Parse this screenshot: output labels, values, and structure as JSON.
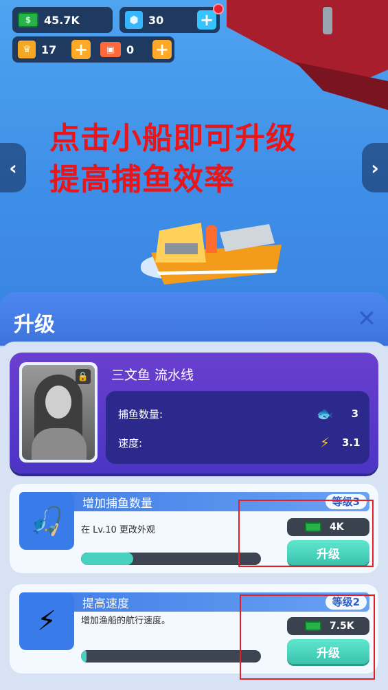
{
  "hud": {
    "cash": "45.7K",
    "gems": "30",
    "crowns": "17",
    "tickets": "0",
    "icons": {
      "cash": "cash-icon",
      "gem": "gem-icon",
      "crown": "crown-icon",
      "ticket": "ticket-icon",
      "plus": "plus-icon"
    }
  },
  "overlay": {
    "line1": "点击小船即可升级",
    "line2": "提高捕鱼效率"
  },
  "nav": {
    "left": "‹",
    "right": "›"
  },
  "panel": {
    "title": "升级",
    "close": "✕",
    "line_name": "三文鱼 流水线",
    "stats": [
      {
        "label": "捕鱼数量:",
        "icon": "fish-icon",
        "value": "3"
      },
      {
        "label": "速度:",
        "icon": "bolt-icon",
        "value": "3.1"
      }
    ]
  },
  "upgrades": [
    {
      "title": "增加捕鱼数量",
      "level": "等级3",
      "description": "在 Lv.10 更改外观",
      "cost": "4K",
      "button": "升级",
      "progress": 0.29,
      "icon": "fishing-hook-icon"
    },
    {
      "title": "提高速度",
      "level": "等级2",
      "description": "增加渔船的航行速度。",
      "cost": "7.5K",
      "button": "升级",
      "progress": 0.03,
      "icon": "lightning-icon"
    }
  ],
  "colors": {
    "accent_blue": "#3f78e0",
    "upgrade_button": "#47d1be",
    "overlay_text": "#e8161a",
    "highlight_box": "#e61f26"
  }
}
